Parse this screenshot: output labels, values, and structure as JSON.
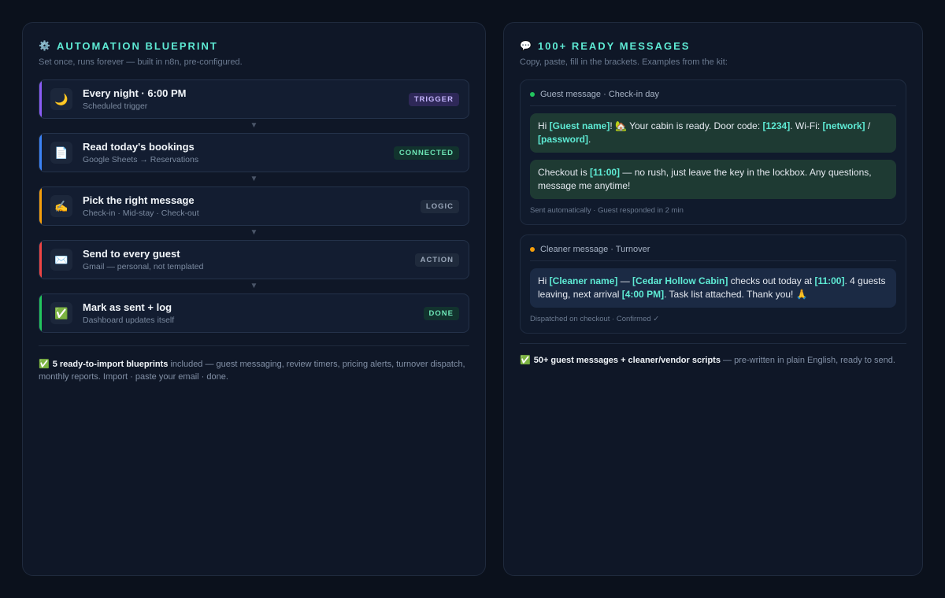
{
  "left": {
    "title_icon": "⚙️",
    "title": "AUTOMATION BLUEPRINT",
    "subtitle": "Set once, runs forever — built in n8n, pre-configured.",
    "steps": [
      {
        "icon": "🌙",
        "title": "Every night · 6:00 PM",
        "desc": "Scheduled trigger",
        "badge": "TRIGGER",
        "accent": "#8b5cf6",
        "badge_bg": "#2e2858",
        "badge_fg": "#c4b5fd"
      },
      {
        "icon": "📄",
        "title": "Read today's bookings",
        "desc": "Google Sheets → Reservations",
        "badge": "CONNECTED",
        "accent": "#3b82f6",
        "badge_bg": "#12332e",
        "badge_fg": "#6ee7b7"
      },
      {
        "icon": "✍️",
        "title": "Pick the right message",
        "desc": "Check-in · Mid-stay · Check-out",
        "badge": "LOGIC",
        "accent": "#f59e0b",
        "badge_bg": "#1f2a3c",
        "badge_fg": "#9aa7ba"
      },
      {
        "icon": "✉️",
        "title": "Send to every guest",
        "desc": "Gmail — personal, not templated",
        "badge": "ACTION",
        "accent": "#ef4444",
        "badge_bg": "#1f2a3c",
        "badge_fg": "#9aa7ba"
      },
      {
        "icon": "✅",
        "title": "Mark as sent + log",
        "desc": "Dashboard updates itself",
        "badge": "DONE",
        "accent": "#22c55e",
        "badge_bg": "#12332e",
        "badge_fg": "#6ee7b7"
      }
    ],
    "connector_glyph": "▼",
    "footnote_check": "✅",
    "footnote_bold": "5 ready-to-import blueprints",
    "footnote_rest": " included — guest messaging, review timers, pricing alerts, turnover dispatch, monthly reports. Import · paste your email · done."
  },
  "right": {
    "title_icon": "💬",
    "title": "100+ READY MESSAGES",
    "subtitle": "Copy, paste, fill in the brackets. Examples from the kit:",
    "cards": [
      {
        "dot_color": "#22c55e",
        "heading": "Guest message · Check-in day",
        "bubble_style": "green",
        "bubbles": [
          [
            {
              "t": "Hi "
            },
            {
              "t": "[Guest name]",
              "ph": true
            },
            {
              "t": "! 🏡 Your cabin is ready. Door code: "
            },
            {
              "t": "[1234]",
              "ph": true
            },
            {
              "t": ". Wi-Fi: "
            },
            {
              "t": "[network]",
              "ph": true
            },
            {
              "t": " / "
            },
            {
              "t": "[password]",
              "ph": true
            },
            {
              "t": "."
            }
          ],
          [
            {
              "t": "Checkout is "
            },
            {
              "t": "[11:00]",
              "ph": true
            },
            {
              "t": " — no rush, just leave the key in the lockbox. Any questions, message me anytime!"
            }
          ]
        ],
        "meta": "Sent automatically · Guest responded in 2 min"
      },
      {
        "dot_color": "#f59e0b",
        "heading": "Cleaner message · Turnover",
        "bubble_style": "blue",
        "bubbles": [
          [
            {
              "t": "Hi "
            },
            {
              "t": "[Cleaner name]",
              "ph": true
            },
            {
              "t": " — "
            },
            {
              "t": "[Cedar Hollow Cabin]",
              "ph": true
            },
            {
              "t": " checks out today at "
            },
            {
              "t": "[11:00]",
              "ph": true
            },
            {
              "t": ". 4 guests leaving, next arrival "
            },
            {
              "t": "[4:00 PM]",
              "ph": true
            },
            {
              "t": ". Task list attached. Thank you! 🙏"
            }
          ]
        ],
        "meta": "Dispatched on checkout · Confirmed ✓"
      }
    ],
    "footnote_check": "✅",
    "footnote_bold": "50+ guest messages + cleaner/vendor scripts",
    "footnote_rest": " — pre-written in plain English, ready to send."
  }
}
